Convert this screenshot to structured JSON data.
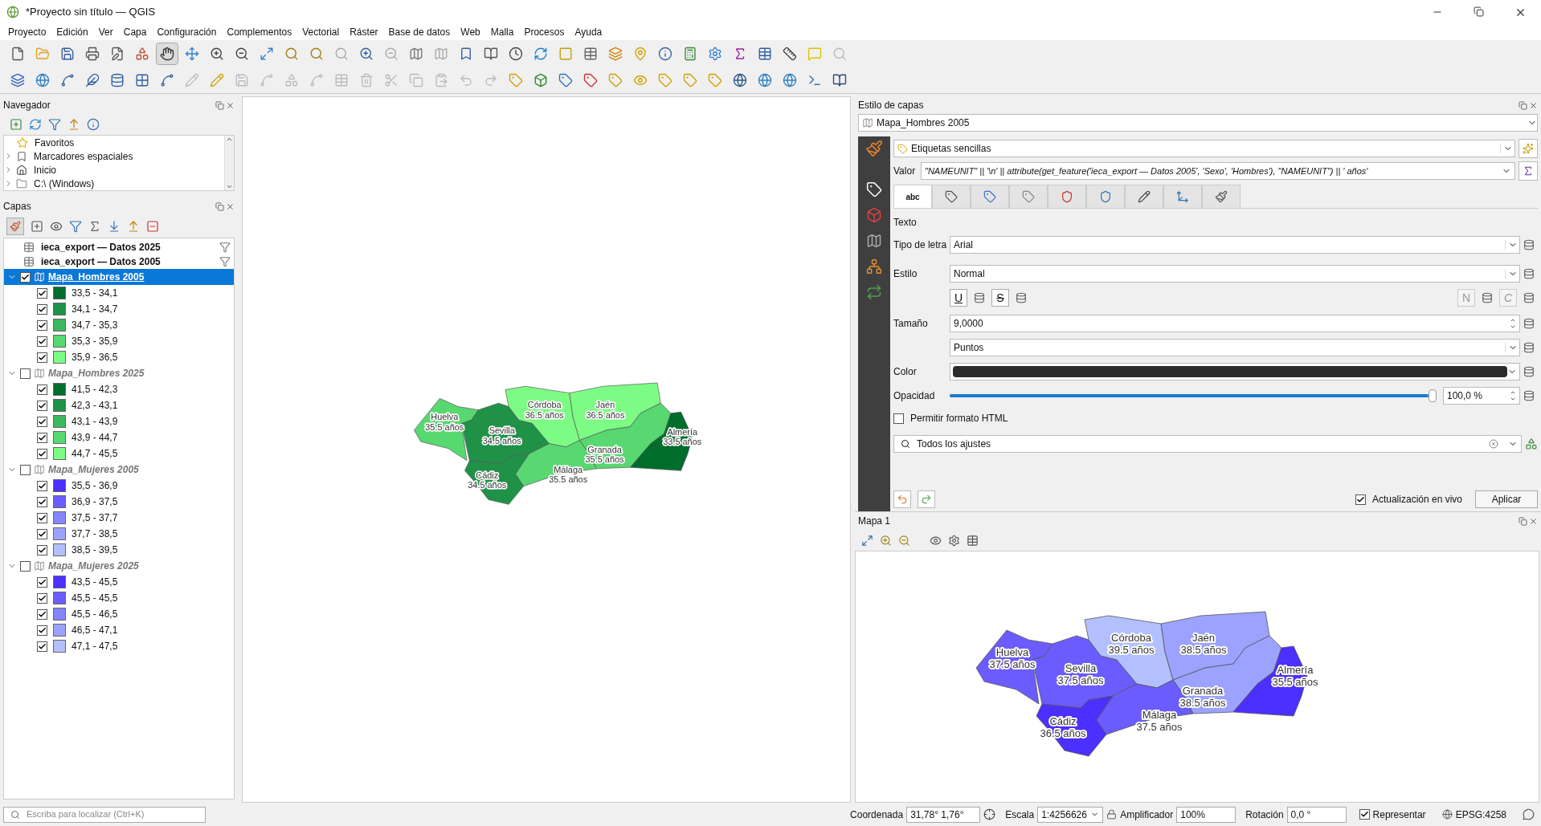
{
  "window": {
    "title": "*Proyecto sin título — QGIS"
  },
  "menu": [
    "Proyecto",
    "Edición",
    "Ver",
    "Capa",
    "Configuración",
    "Complementos",
    "Vectorial",
    "Ráster",
    "Base de datos",
    "Web",
    "Malla",
    "Procesos",
    "Ayuda"
  ],
  "navigator": {
    "title": "Navegador",
    "items": [
      {
        "label": "Favoritos",
        "kind": "favorites"
      },
      {
        "label": "Marcadores espaciales",
        "kind": "bookmarks"
      },
      {
        "label": "Inicio",
        "kind": "home"
      },
      {
        "label": "C:\\ (Windows)",
        "kind": "drive"
      }
    ]
  },
  "layers": {
    "title": "Capas",
    "tables": [
      {
        "name": "ieca_export — Datos 2025"
      },
      {
        "name": "ieca_export — Datos 2005"
      }
    ],
    "groups": [
      {
        "name": "Mapa_Hombres 2005",
        "checked": true,
        "selected": true,
        "expanded": true,
        "classes": [
          {
            "label": "33,5 - 34,1",
            "color": "#006d2c",
            "checked": true
          },
          {
            "label": "34,1 - 34,7",
            "color": "#1f9248",
            "checked": true
          },
          {
            "label": "34,7 - 35,3",
            "color": "#3cb860",
            "checked": true
          },
          {
            "label": "35,3 - 35,9",
            "color": "#58d870",
            "checked": true
          },
          {
            "label": "35,9 - 36,5",
            "color": "#7cfc84",
            "checked": true
          }
        ]
      },
      {
        "name": "Mapa_Hombres 2025",
        "checked": false,
        "selected": false,
        "expanded": true,
        "classes": [
          {
            "label": "41,5 - 42,3",
            "color": "#006d2c",
            "checked": true
          },
          {
            "label": "42,3 - 43,1",
            "color": "#1f9248",
            "checked": true
          },
          {
            "label": "43,1 - 43,9",
            "color": "#3cb860",
            "checked": true
          },
          {
            "label": "43,9 - 44,7",
            "color": "#58d870",
            "checked": true
          },
          {
            "label": "44,7 - 45,5",
            "color": "#7cfc84",
            "checked": true
          }
        ]
      },
      {
        "name": "Mapa_Mujeres 2005",
        "checked": false,
        "selected": false,
        "expanded": true,
        "classes": [
          {
            "label": "35,5 - 36,9",
            "color": "#4b30ff",
            "checked": true
          },
          {
            "label": "36,9 - 37,5",
            "color": "#6b5cff",
            "checked": true
          },
          {
            "label": "37,5 - 37,7",
            "color": "#8585ff",
            "checked": true
          },
          {
            "label": "37,7 - 38,5",
            "color": "#9ca2ff",
            "checked": true
          },
          {
            "label": "38,5 - 39,5",
            "color": "#b3c0ff",
            "checked": true
          }
        ]
      },
      {
        "name": "Mapa_Mujeres 2025",
        "checked": false,
        "selected": false,
        "expanded": true,
        "classes": [
          {
            "label": "43,5 - 45,5",
            "color": "#4b30ff",
            "checked": true
          },
          {
            "label": "45,5 - 45,5",
            "color": "#6b5cff",
            "checked": true
          },
          {
            "label": "45,5 - 46,5",
            "color": "#8585ff",
            "checked": true
          },
          {
            "label": "46,5 - 47,1",
            "color": "#9ca2ff",
            "checked": true
          },
          {
            "label": "47,1 - 47,5",
            "color": "#b3c0ff",
            "checked": true
          }
        ]
      }
    ]
  },
  "canvas_map": {
    "provinces": [
      {
        "name": "Huelva",
        "value": "35.5 años",
        "color": "#58d870"
      },
      {
        "name": "Sevilla",
        "value": "34.5 años",
        "color": "#1f9248"
      },
      {
        "name": "Córdoba",
        "value": "36.5 años",
        "color": "#7cfc84"
      },
      {
        "name": "Jaén",
        "value": "36.5 años",
        "color": "#7cfc84"
      },
      {
        "name": "Granada",
        "value": "35.5 años",
        "color": "#58d870"
      },
      {
        "name": "Almería",
        "value": "33.5 años",
        "color": "#006d2c"
      },
      {
        "name": "Málaga",
        "value": "35.5 años",
        "color": "#58d870"
      },
      {
        "name": "Cádiz",
        "value": "34.5 años",
        "color": "#1f9248"
      }
    ]
  },
  "layer_style": {
    "title": "Estilo de capas",
    "layer": "Mapa_Hombres 2005",
    "mode": "Etiquetas sencillas",
    "value_label": "Valor",
    "expression": "\"NAMEUNIT\" || '\\n' || attribute(get_feature('ieca_export — Datos 2005', 'Sexo', 'Hombres'), \"NAMEUNIT\") || ' años'",
    "tabs": [
      {
        "label": "abc",
        "selected": true
      },
      {
        "selected": false
      },
      {
        "selected": false
      },
      {
        "selected": false
      },
      {
        "selected": false
      },
      {
        "selected": false
      },
      {
        "selected": false
      },
      {
        "selected": false
      },
      {
        "selected": false
      }
    ],
    "section": "Texto",
    "font_label": "Tipo de letra",
    "font": "Arial",
    "style_label": "Estilo",
    "style": "Normal",
    "underline": "U",
    "strike": "S",
    "normal_btn": "N",
    "italic_btn": "C",
    "size_label": "Tamaño",
    "size": "9,0000",
    "unit": "Puntos",
    "color_label": "Color",
    "color": "#2b2b2b",
    "opacity_label": "Opacidad",
    "opacity": {
      "level": 1.0,
      "reading": "100,0 %"
    },
    "html": {
      "label": "Permitir formato HTML",
      "checked": false
    },
    "search": {
      "value": "Todos los ajustes"
    },
    "live": {
      "label": "Actualización en vivo",
      "checked": true
    },
    "apply": "Aplicar"
  },
  "map_panel": {
    "title": "Mapa 1",
    "provinces": [
      {
        "name": "Huelva",
        "value": "37.5 años",
        "color": "#6b5cff"
      },
      {
        "name": "Sevilla",
        "value": "37.5 años",
        "color": "#6b5cff"
      },
      {
        "name": "Córdoba",
        "value": "39.5 años",
        "color": "#b3c0ff"
      },
      {
        "name": "Jaén",
        "value": "38.5 años",
        "color": "#9ca2ff"
      },
      {
        "name": "Granada",
        "value": "38.5 años",
        "color": "#9ca2ff"
      },
      {
        "name": "Almería",
        "value": "35.5 años",
        "color": "#4b30ff"
      },
      {
        "name": "Málaga",
        "value": "37.5 años",
        "color": "#6b5cff"
      },
      {
        "name": "Cádiz",
        "value": "36.5 años",
        "color": "#4b30ff"
      }
    ]
  },
  "status_bar": {
    "search": {
      "placeholder": "Escriba para localizar (Ctrl+K)"
    },
    "coord_label": "Coordenada",
    "coord": "31,78° 1,76°",
    "scale_label": "Escala",
    "scale": "1:4256626",
    "magnifier_label": "Amplificador",
    "magnifier": "100%",
    "rotation_label": "Rotación",
    "rotation": "0,0 °",
    "render": {
      "label": "Representar",
      "checked": true
    },
    "crs": "EPSG:4258"
  }
}
